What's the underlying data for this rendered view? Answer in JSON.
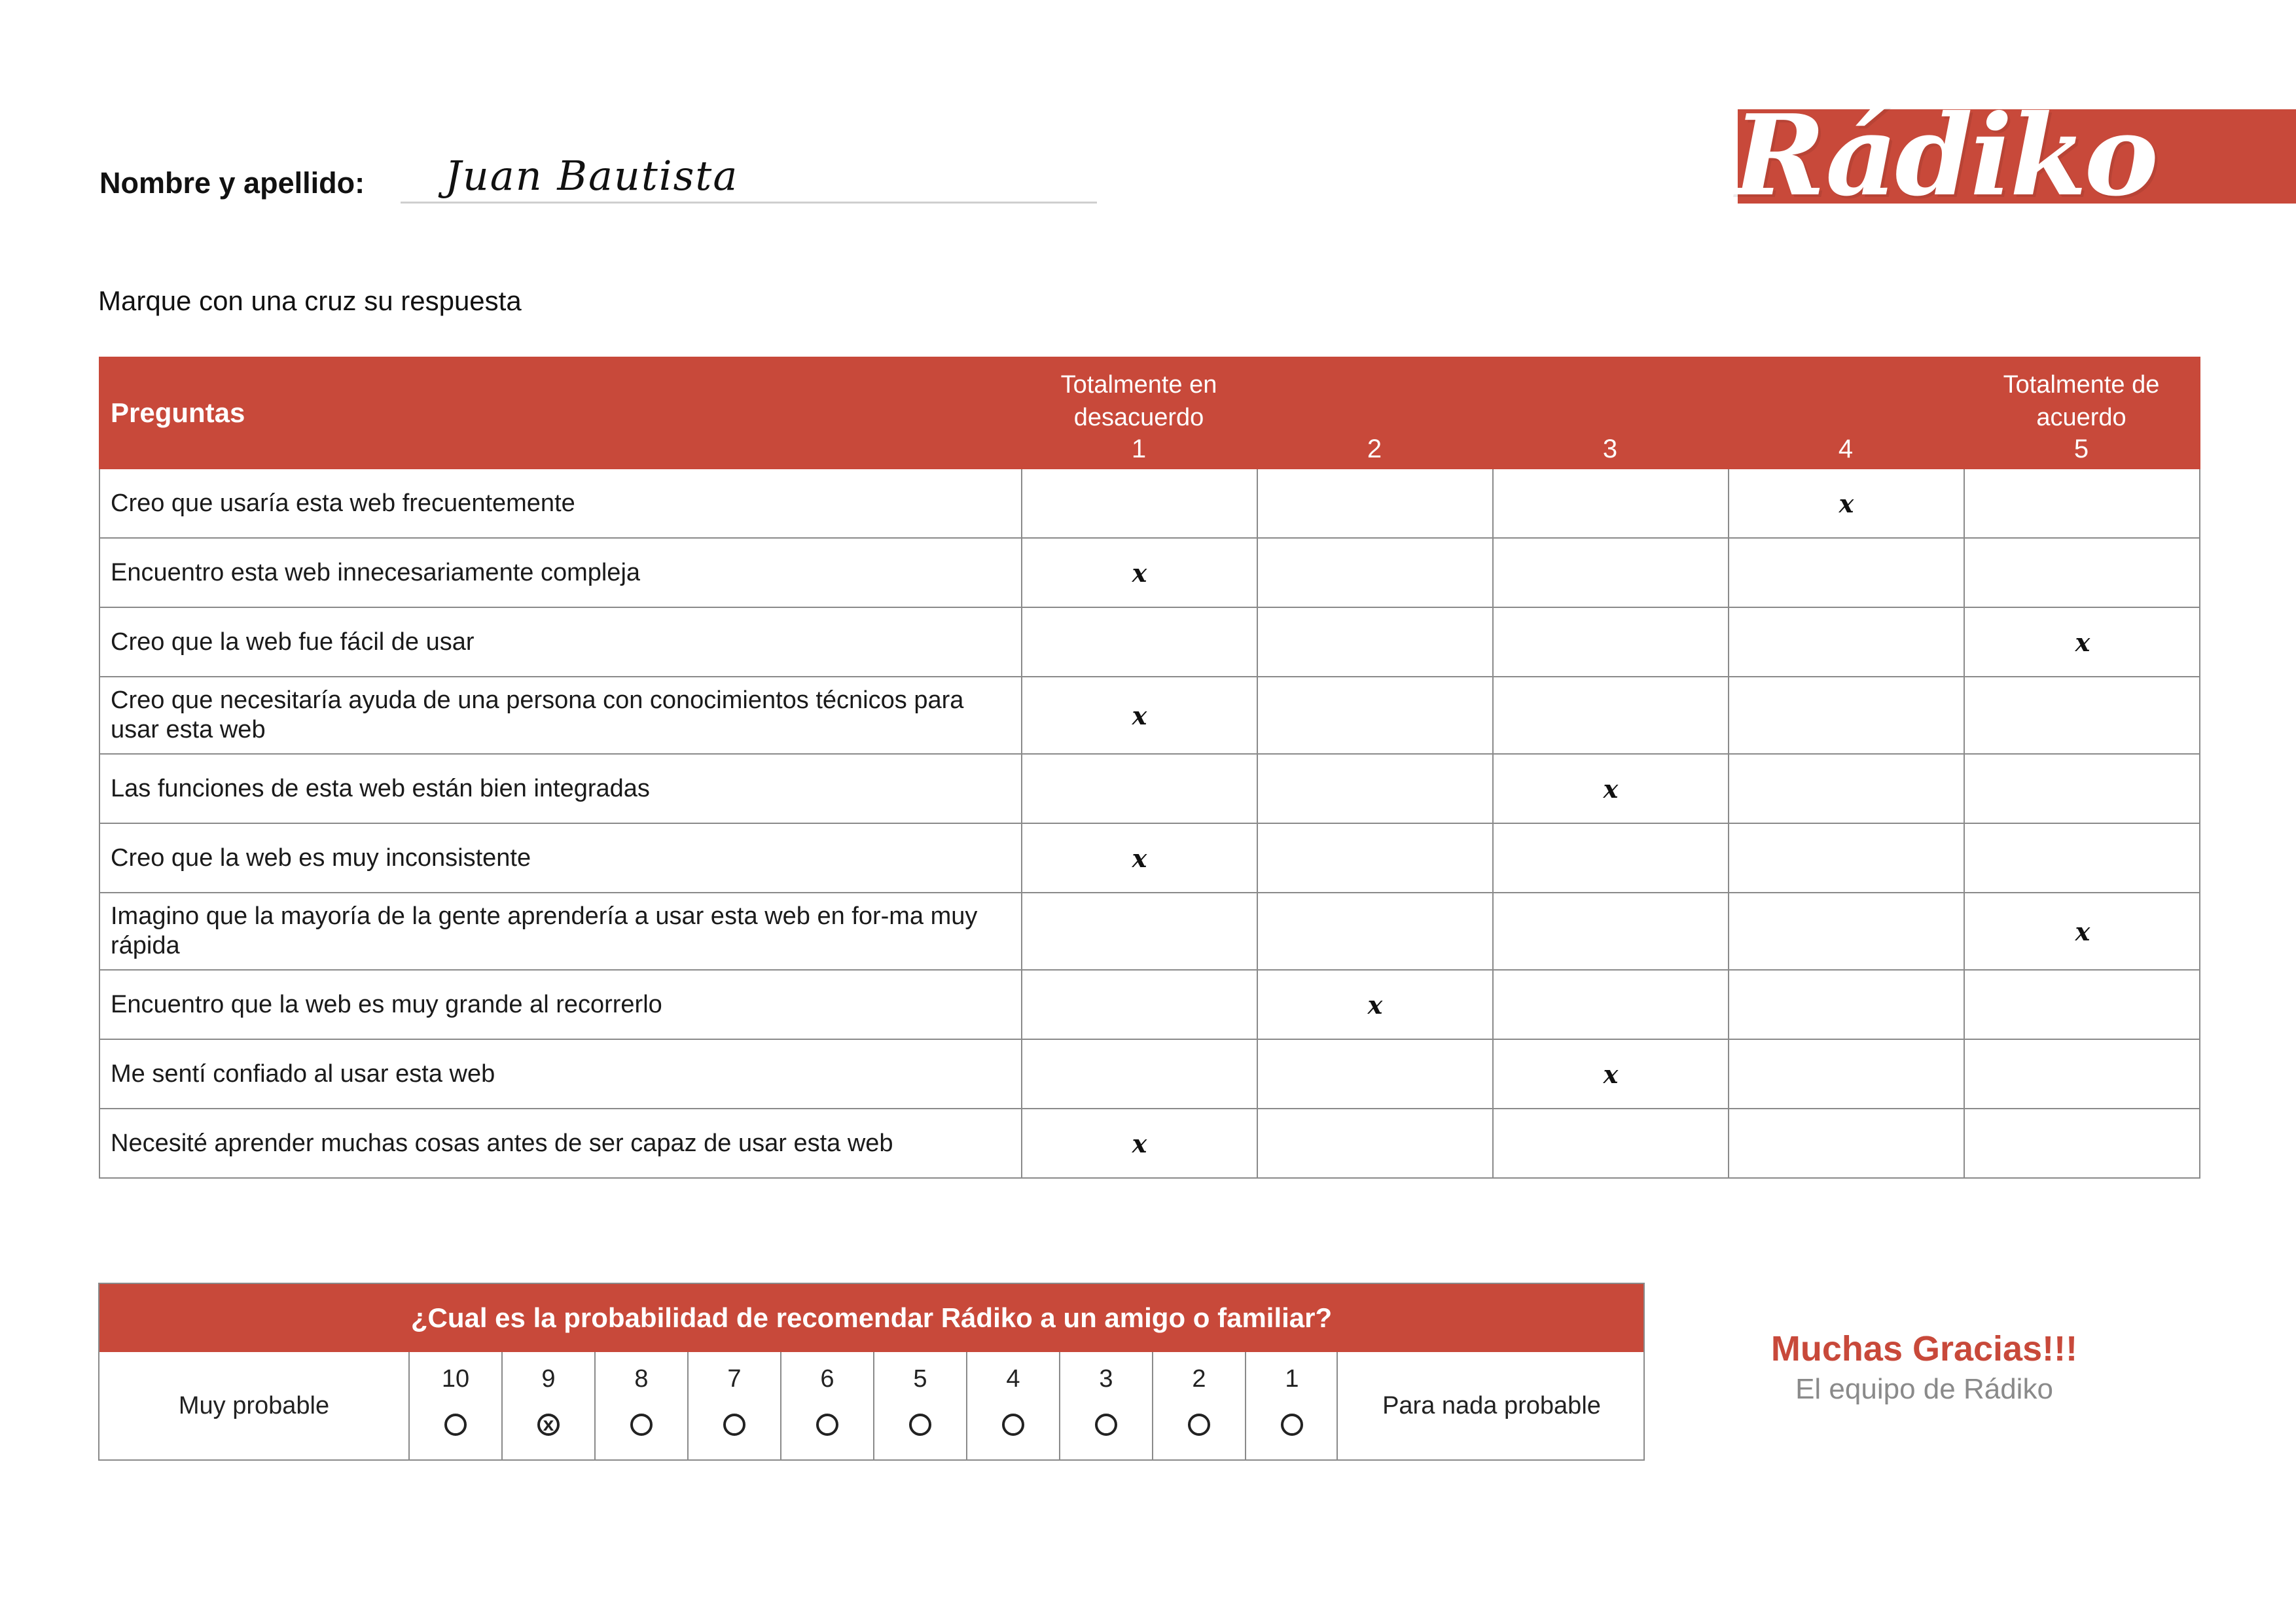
{
  "header": {
    "name_label": "Nombre y apellido:",
    "name_value": "Juan Bautista",
    "logo": "Rádiko",
    "instructions": "Marque con una cruz su respuesta"
  },
  "colors": {
    "accent": "#c8493a",
    "border": "#8a8a8a",
    "muted_text": "#8a8a8a"
  },
  "survey": {
    "column_title": "Preguntas",
    "scale": [
      {
        "caption": "Totalmente en desacuerdo",
        "number": "1"
      },
      {
        "caption": "",
        "number": "2"
      },
      {
        "caption": "",
        "number": "3"
      },
      {
        "caption": "",
        "number": "4"
      },
      {
        "caption": "Totalmente de acuerdo",
        "number": "5"
      }
    ],
    "mark_symbol": "x",
    "rows": [
      {
        "question": "Creo que usaría esta web frecuentemente",
        "answer": 4
      },
      {
        "question": "Encuentro esta web innecesariamente compleja",
        "answer": 1
      },
      {
        "question": "Creo que la web fue fácil de usar",
        "answer": 5
      },
      {
        "question": "Creo que necesitaría ayuda de una persona con conocimientos técnicos para usar esta web",
        "answer": 1
      },
      {
        "question": "Las funciones de esta web están bien integradas",
        "answer": 3
      },
      {
        "question": "Creo que la web es muy inconsistente",
        "answer": 1
      },
      {
        "question": "Imagino que la mayoría de la gente aprendería a usar esta web en for-ma muy rápida",
        "answer": 5
      },
      {
        "question": "Encuentro que la web es muy grande al recorrerlo",
        "answer": 2
      },
      {
        "question": "Me sentí confiado al usar esta web",
        "answer": 3
      },
      {
        "question": "Necesité aprender muchas cosas antes de ser capaz de usar esta web",
        "answer": 1
      }
    ]
  },
  "nps": {
    "title": "¿Cual es la probabilidad de recomendar Rádiko a un amigo o familiar?",
    "left_label": "Muy probable",
    "right_label": "Para nada probable",
    "options": [
      "10",
      "9",
      "8",
      "7",
      "6",
      "5",
      "4",
      "3",
      "2",
      "1"
    ],
    "selected": "9"
  },
  "thanks": {
    "title": "Muchas Gracias!!!",
    "subtitle": "El equipo de Rádiko"
  }
}
